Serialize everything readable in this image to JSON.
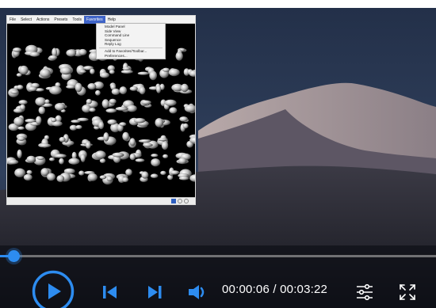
{
  "player": {
    "current_time": "00:00:06",
    "separator": " / ",
    "duration": "00:03:22",
    "progress": 0.03,
    "accent_color": "#2d8cf0"
  },
  "embedded_window": {
    "menu": [
      "File",
      "Select",
      "Actions",
      "Presets",
      "Tools",
      "Favorites",
      "Help"
    ],
    "active_menu": "Favorites",
    "dropdown_items": [
      "Model Panel",
      "Side View",
      "Command Line",
      "Sequence",
      "Reply Log",
      "---",
      "Add to Favorites/Toolbar...",
      "Preferences..."
    ]
  },
  "icons": {
    "play": "play-icon",
    "previous": "skip-previous-icon",
    "next": "skip-next-icon",
    "volume": "volume-icon",
    "settings": "sliders-icon",
    "fullscreen": "fullscreen-icon"
  }
}
